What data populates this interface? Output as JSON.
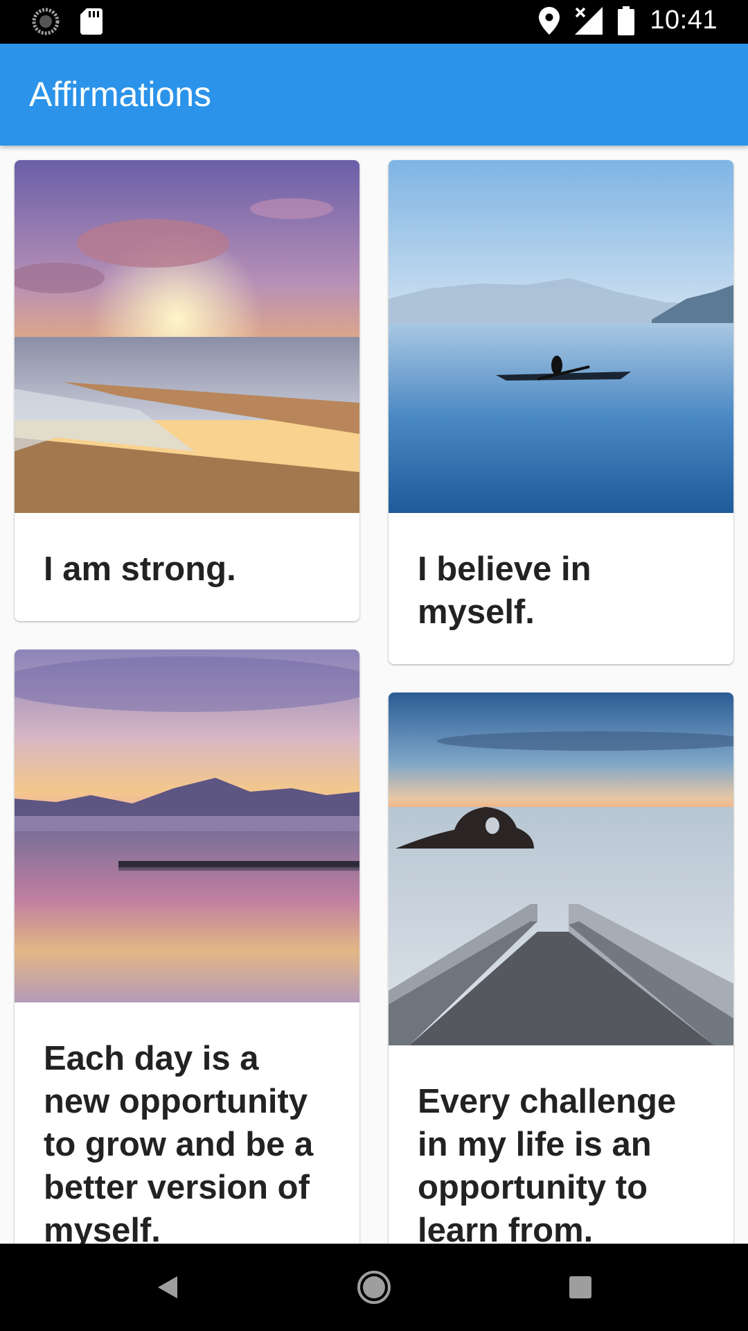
{
  "status_bar": {
    "time": "10:41",
    "icons": [
      "sync-icon",
      "sd-card-icon",
      "location-icon",
      "no-signal-icon",
      "battery-icon"
    ]
  },
  "app_bar": {
    "title": "Affirmations",
    "color": "#2b93e9"
  },
  "cards": [
    {
      "text": "I am strong.",
      "image": "sunset-beach-image"
    },
    {
      "text": "I believe in myself.",
      "image": "kayak-lake-image"
    },
    {
      "text": "Each day is a new opportunity to grow and be a better version of myself.",
      "image": "mountain-lake-sunset-image"
    },
    {
      "text": "Every challenge in my life is an opportunity to learn from.",
      "image": "stairs-to-sea-image"
    }
  ],
  "nav_bar": {
    "icons": [
      "back-icon",
      "home-icon",
      "recents-icon"
    ]
  }
}
